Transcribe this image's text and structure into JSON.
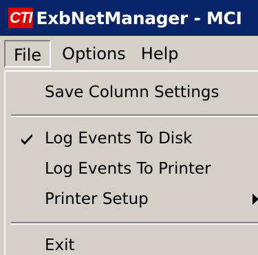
{
  "window": {
    "logo_text": "CTI",
    "title": "ExbNetManager - MCI"
  },
  "menubar": {
    "items": [
      {
        "label": "File"
      },
      {
        "label": "Options"
      },
      {
        "label": "Help"
      }
    ]
  },
  "file_menu": {
    "items": [
      {
        "label": "Save Column Settings",
        "checked": false
      },
      {
        "label": "Log Events To Disk",
        "checked": true
      },
      {
        "label": "Log Events To Printer",
        "checked": false
      },
      {
        "label": "Printer Setup",
        "has_submenu": true
      },
      {
        "label": "Exit"
      }
    ]
  },
  "icons": {
    "check": "checkmark-icon",
    "submenu": "submenu-arrow-icon"
  },
  "colors": {
    "titlebar": "#0a246a",
    "logo_bg": "#e00000",
    "face": "#d4d0c8"
  }
}
